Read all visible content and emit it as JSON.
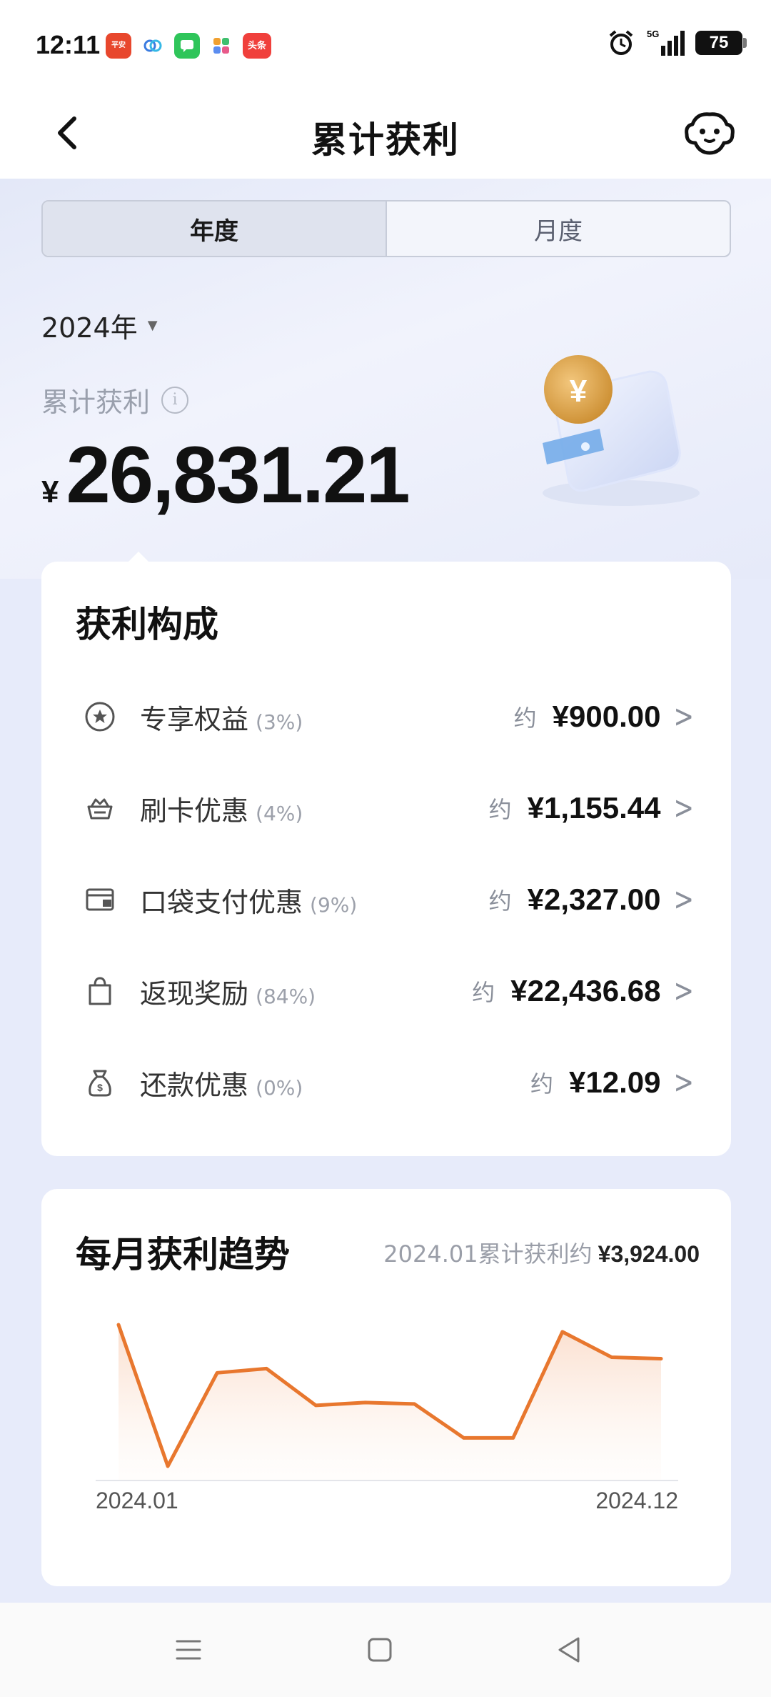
{
  "status_bar": {
    "time": "12:11",
    "apps": [
      {
        "label": "平安银行",
        "color": "#e8472d"
      },
      {
        "label": "",
        "color": "#ffffff"
      },
      {
        "label": "",
        "color": "#2fc55a"
      },
      {
        "label": "",
        "color": "#ffffff"
      },
      {
        "label": "头条",
        "color": "#f0403c"
      }
    ],
    "network": "5G",
    "battery": "75"
  },
  "nav": {
    "title": "累计获利"
  },
  "tabs": [
    {
      "label": "年度",
      "active": true
    },
    {
      "label": "月度",
      "active": false
    }
  ],
  "year_select": {
    "value": "2024年"
  },
  "summary": {
    "label": "累计获利",
    "currency": "¥",
    "amount": "26,831.21"
  },
  "composition": {
    "title": "获利构成",
    "items": [
      {
        "icon": "star-badge-icon",
        "name": "专享权益",
        "pct": "(3%)",
        "approx": "约",
        "amount": "¥900.00"
      },
      {
        "icon": "basket-icon",
        "name": "刷卡优惠",
        "pct": "(4%)",
        "approx": "约",
        "amount": "¥1,155.44"
      },
      {
        "icon": "wallet-card-icon",
        "name": "口袋支付优惠",
        "pct": "(9%)",
        "approx": "约",
        "amount": "¥2,327.00"
      },
      {
        "icon": "shopping-bag-icon",
        "name": "返现奖励",
        "pct": "(84%)",
        "approx": "约",
        "amount": "¥22,436.68"
      },
      {
        "icon": "money-bag-icon",
        "name": "还款优惠",
        "pct": "(0%)",
        "approx": "约",
        "amount": "¥12.09"
      }
    ]
  },
  "trend": {
    "title": "每月获利趋势",
    "summary_label": "2024.01累计获利约",
    "summary_amount": "¥3,924.00",
    "x_start": "2024.01",
    "x_end": "2024.12",
    "line_color": "#e8772e"
  },
  "chart_data": {
    "type": "line",
    "x": [
      "2024.01",
      "2024.02",
      "2024.03",
      "2024.04",
      "2024.05",
      "2024.06",
      "2024.07",
      "2024.08",
      "2024.09",
      "2024.10",
      "2024.11",
      "2024.12"
    ],
    "series": [
      {
        "values": [
          100,
          0,
          66,
          69,
          43,
          45,
          44,
          20,
          20,
          95,
          77,
          76
        ]
      }
    ],
    "note_unit": "relative level (0=lowest, 100=highest); y axis unlabeled"
  }
}
